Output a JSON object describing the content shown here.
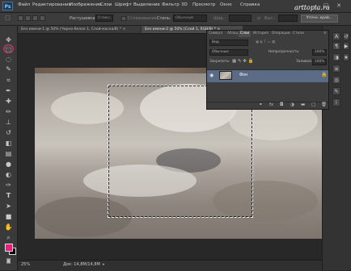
{
  "app": {
    "logo": "Ps",
    "watermark": "arttopia.ru"
  },
  "menu": [
    "Файл",
    "Редактирование",
    "Изображение",
    "Слои",
    "Шрифт",
    "Выделение",
    "Фильтр",
    "3D",
    "Просмотр",
    "Окно",
    "Справка"
  ],
  "window_buttons": {
    "minimize": "–",
    "maximize": "□",
    "close": "✕"
  },
  "options": {
    "feather_label": "Растушевка:",
    "feather_value": "0 пикс.",
    "antialias_label": "Сглаживание",
    "style_label": "Стиль:",
    "style_value": "Обычный",
    "width_label": "Шир.:",
    "height_label": "Выс.:",
    "refine_edge": "Уточн. край..."
  },
  "documents": {
    "tab1": "Без имени-1 @ 50% (Черно-белое 1, Слой-маска/8) *",
    "tab2": "Без имени-2 @ 50% (Слой 1, RGB/8) *",
    "tab_close": "×"
  },
  "status": {
    "zoom": "25%",
    "doc_size": "Док: 14,8M/14,8M"
  },
  "colors": {
    "foreground": "#e4207a",
    "background": "#000000"
  },
  "layers_panel": {
    "tabs": [
      "Символ",
      "Абзац",
      "Слои",
      "История",
      "Операции",
      "Стили"
    ],
    "active_tab": "Слои",
    "kind_filter": "Вид",
    "blend_mode": "Обычные",
    "opacity_label": "Непрозрачность:",
    "opacity_value": "100%",
    "lock_label": "Закрепить:",
    "fill_label": "Заливка:",
    "fill_value": "100%",
    "layer_name": "Фон"
  },
  "icons": {
    "tools": [
      "move-tool-icon",
      "rect-marquee-tool-icon",
      "lasso-tool-icon",
      "quick-select-tool-icon",
      "crop-tool-icon",
      "eyedropper-tool-icon",
      "healing-brush-tool-icon",
      "brush-tool-icon",
      "clone-stamp-tool-icon",
      "history-brush-tool-icon",
      "eraser-tool-icon",
      "gradient-tool-icon",
      "blur-tool-icon",
      "dodge-tool-icon",
      "pen-tool-icon",
      "type-tool-icon",
      "path-select-tool-icon",
      "rectangle-shape-tool-icon",
      "hand-tool-icon",
      "zoom-tool-icon"
    ]
  }
}
